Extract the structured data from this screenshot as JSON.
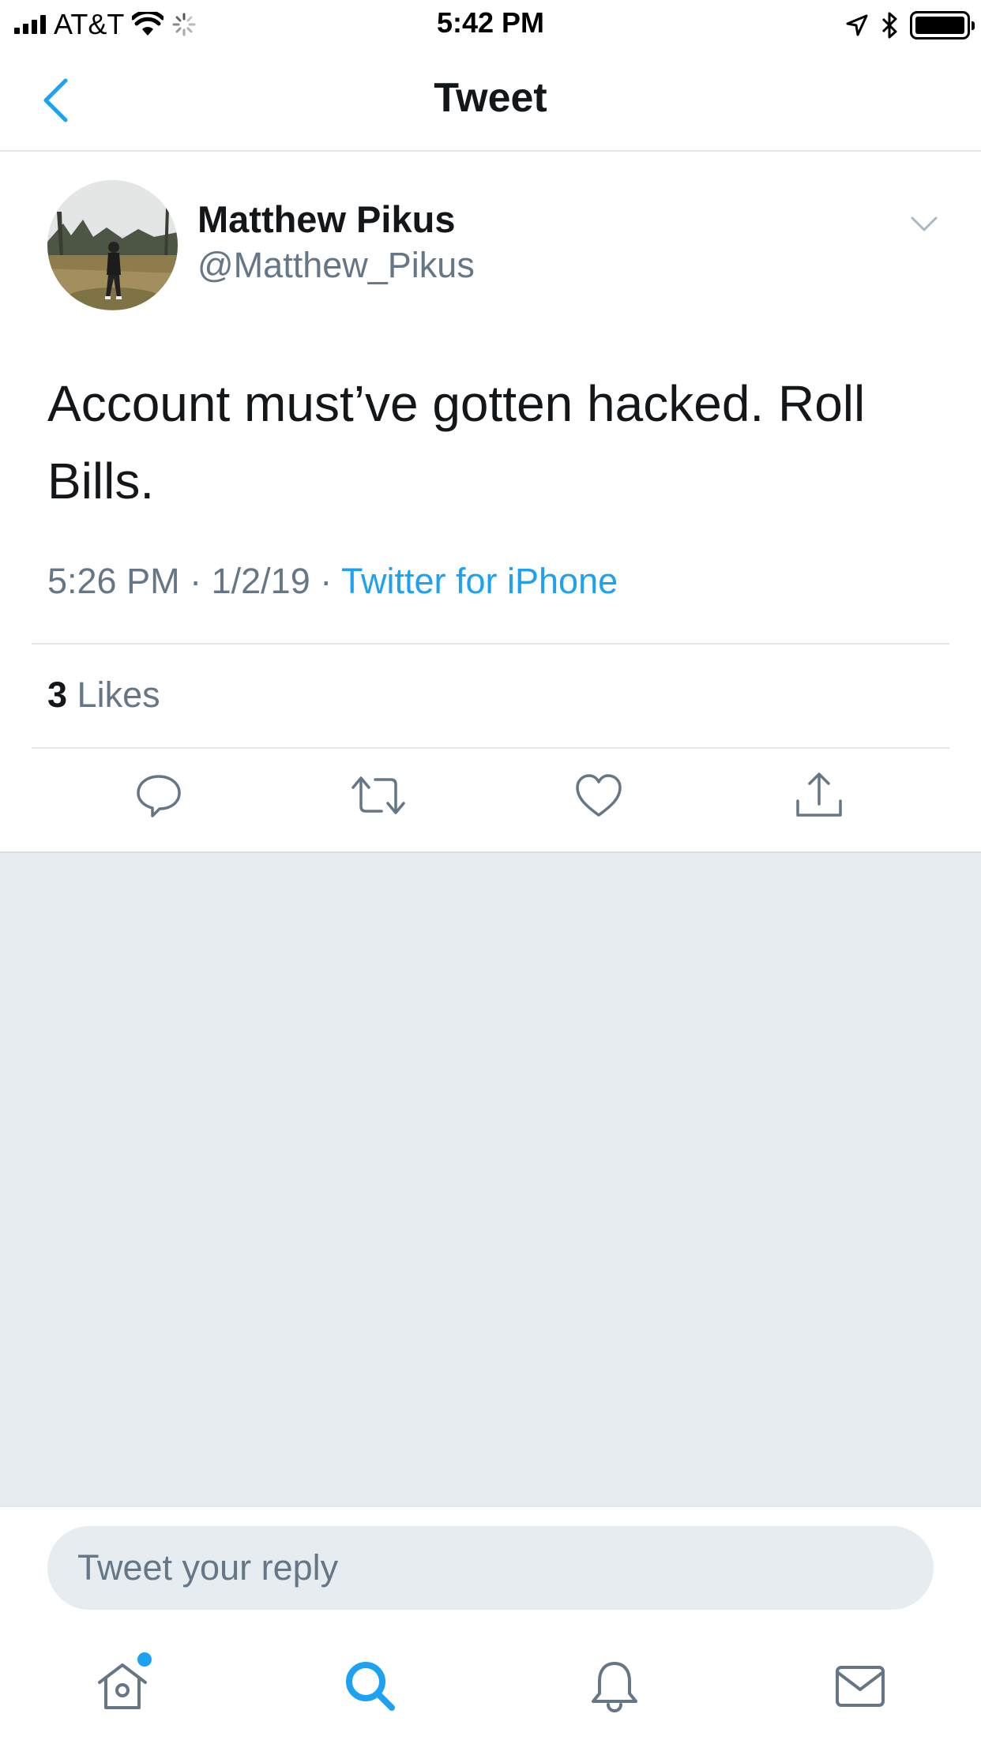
{
  "status_bar": {
    "carrier": "AT&T",
    "time": "5:42 PM"
  },
  "nav": {
    "title": "Tweet"
  },
  "tweet": {
    "display_name": "Matthew Pikus",
    "handle": "@Matthew_Pikus",
    "text": "Account must’ve gotten hacked. Roll Bills.",
    "time": "5:26 PM",
    "separator": "·",
    "date": "1/2/19",
    "source": "Twitter for iPhone",
    "likes_count": "3",
    "likes_label": "Likes"
  },
  "reply": {
    "placeholder": "Tweet your reply"
  },
  "tabs": {
    "home_icon": "home-icon",
    "search_icon": "search-icon",
    "notifications_icon": "bell-icon",
    "messages_icon": "mail-icon"
  },
  "colors": {
    "accent": "#1da1f2",
    "secondary_text": "#657786",
    "primary_text": "#14171a",
    "background_gray": "#e6ecf0",
    "divider": "#e1e8ed"
  }
}
